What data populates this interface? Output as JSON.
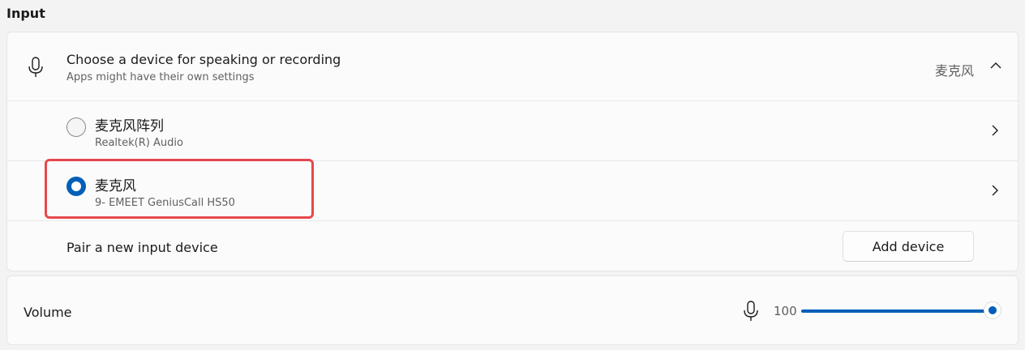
{
  "section": {
    "title": "Input"
  },
  "device_picker": {
    "icon": "microphone-icon",
    "title": "Choose a device for speaking or recording",
    "subtitle": "Apps might have their own settings",
    "selected_value": "麦克风",
    "expanded": true
  },
  "devices": [
    {
      "name": "麦克风阵列",
      "detail": "Realtek(R) Audio",
      "selected": false
    },
    {
      "name": "麦克风",
      "detail": "9- EMEET GeniusCall HS50",
      "selected": true
    }
  ],
  "pair": {
    "label": "Pair a new input device",
    "button_label": "Add device"
  },
  "volume": {
    "label": "Volume",
    "icon": "microphone-icon",
    "value": "100",
    "level_percent": 100
  },
  "colors": {
    "accent": "#005fb8",
    "highlight_box": "#e5484d"
  }
}
